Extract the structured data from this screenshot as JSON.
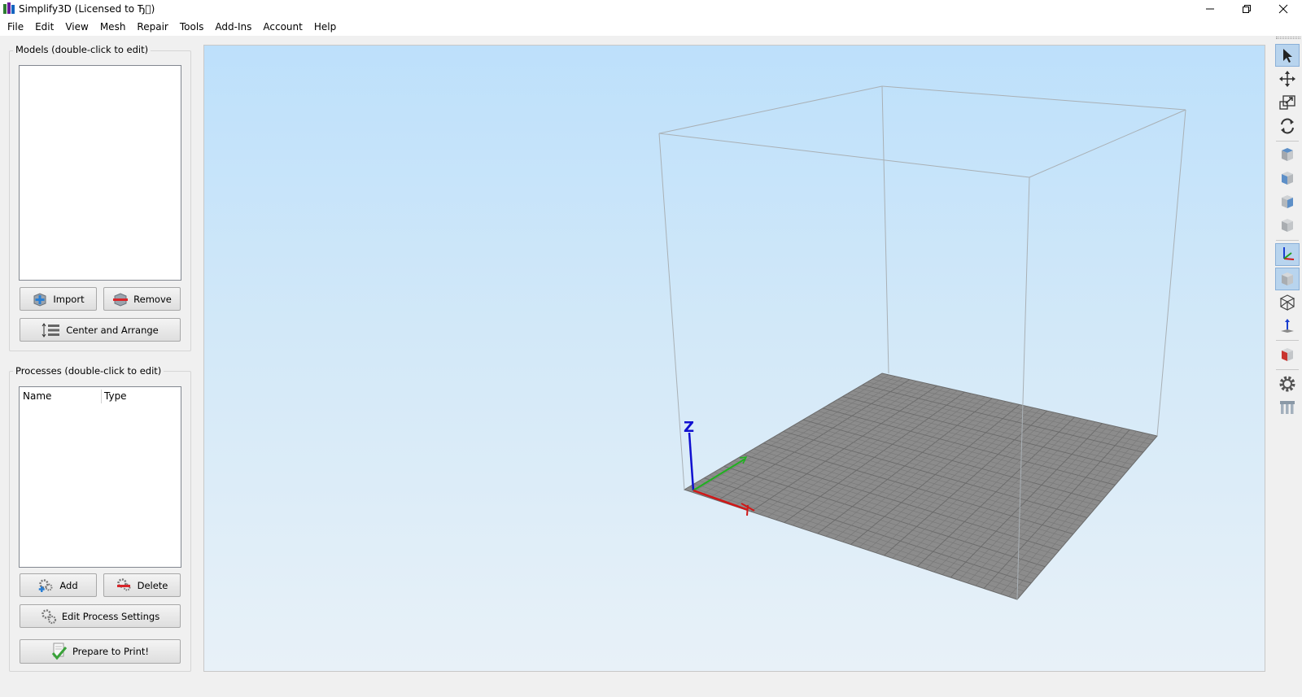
{
  "window": {
    "title": "Simplify3D (Licensed to Ђ⃞)",
    "controls": [
      "minimize",
      "restore",
      "close"
    ]
  },
  "menu": [
    "File",
    "Edit",
    "View",
    "Mesh",
    "Repair",
    "Tools",
    "Add-Ins",
    "Account",
    "Help"
  ],
  "models_panel": {
    "title": "Models (double-click to edit)",
    "import_label": "Import",
    "remove_label": "Remove",
    "center_arrange_label": "Center and Arrange"
  },
  "processes_panel": {
    "title": "Processes (double-click to edit)",
    "columns": [
      "Name",
      "Type"
    ],
    "add_label": "Add",
    "delete_label": "Delete",
    "edit_settings_label": "Edit Process Settings",
    "prepare_label": "Prepare to Print!"
  },
  "viewport": {
    "axis_z_label": "Z"
  },
  "toolbar_icons": [
    "select-icon",
    "move-icon",
    "scale-icon",
    "rotate-icon",
    "view-top-cube-icon",
    "view-front-cube-icon",
    "view-right-cube-icon",
    "view-iso-cube-icon",
    "show-axes-icon",
    "solid-view-icon",
    "wireframe-view-icon",
    "show-normal-icon",
    "cross-section-icon",
    "settings-gear-icon",
    "supports-icon"
  ]
}
